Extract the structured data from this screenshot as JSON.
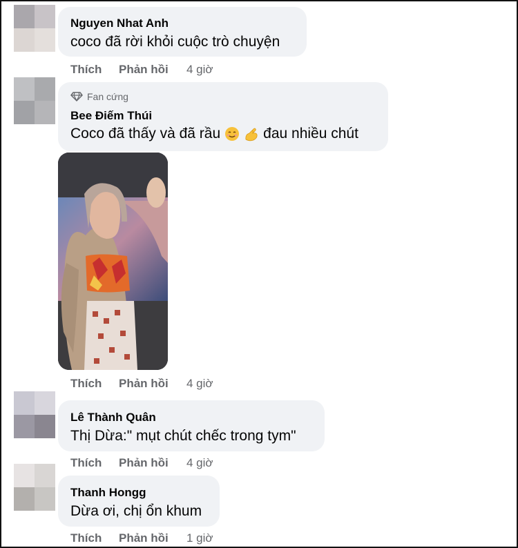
{
  "comments": [
    {
      "author": "Nguyen Nhat Anh",
      "text": "coco đã rời khỏi cuộc trò chuyện",
      "like_label": "Thích",
      "reply_label": "Phản hồi",
      "time": "4 giờ",
      "avatar_colors": [
        "#aaa7ac",
        "#c8c3c7",
        "#dcd6d3",
        "#e4dfdc"
      ]
    },
    {
      "badge": "Fan cứng",
      "badge_icon": "diamond-icon",
      "author": "Bee Điếm Thúi",
      "text": "Coco đã thấy và đã rầu",
      "text_suffix": "đau nhiều chút",
      "emojis": [
        "smiling-face-icon",
        "pinching-hand-icon"
      ],
      "like_label": "Thích",
      "reply_label": "Phản hồi",
      "time": "4 giờ",
      "avatar_colors": [
        "#bfc0c3",
        "#a9aaad",
        "#a1a2a6",
        "#b5b5b8"
      ],
      "attachment": "photo"
    },
    {
      "author": "Lê Thành Quân",
      "text": "Thị Dừa:\" mụt chút chếc trong tym\"",
      "like_label": "Thích",
      "reply_label": "Phản hồi",
      "time": "4 giờ",
      "avatar_colors": [
        "#c9c8d2",
        "#d8d6dd",
        "#9b98a3",
        "#8a8690"
      ]
    },
    {
      "author": "Thanh Hongg",
      "text": "Dừa ơi, chị ổn khum",
      "like_label": "Thích",
      "reply_label": "Phản hồi",
      "time": "1 giờ",
      "avatar_colors": [
        "#e7e3e3",
        "#d9d6d4",
        "#b3b0ad",
        "#c8c6c3"
      ]
    }
  ],
  "colors": {
    "bubble_bg": "#f0f2f5",
    "name_text": "#050505",
    "meta_text": "#65676b",
    "frame_border": "#111111"
  }
}
